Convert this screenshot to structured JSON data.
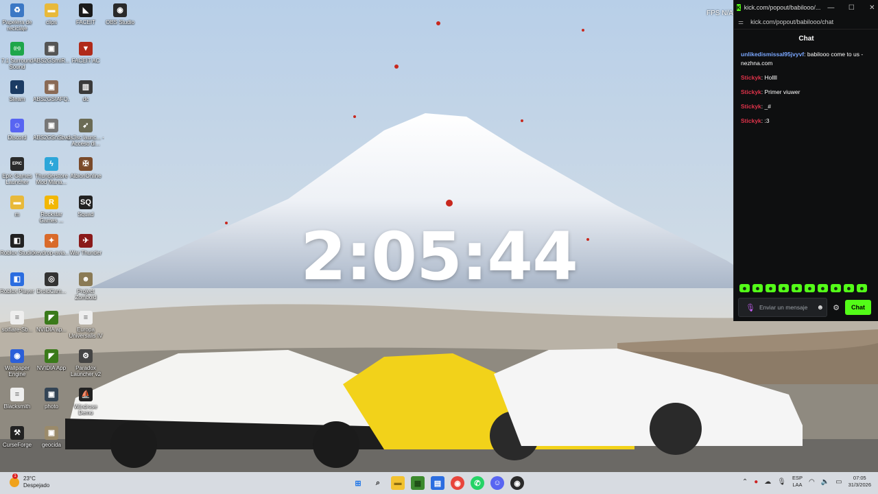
{
  "desktop": {
    "icons": [
      {
        "label": "Papelera de reciclaje",
        "glyph": "♻",
        "color": "#3b78c5",
        "icon": "recycle-bin-icon"
      },
      {
        "label": "clips",
        "glyph": "▬",
        "color": "#e8b93a",
        "icon": "folder-icon"
      },
      {
        "label": "FACEIT",
        "glyph": "◣",
        "color": "#1a1a1a",
        "icon": "faceit-icon"
      },
      {
        "label": "OBS Studio",
        "glyph": "◉",
        "color": "#2a2a2a",
        "icon": "obs-icon"
      },
      {
        "label": "7.1 Surround Sound",
        "glyph": "((•))",
        "color": "#1ea64a",
        "icon": "surround-sound-icon"
      },
      {
        "label": "ABS2GSmIR...",
        "glyph": "▣",
        "color": "#555555",
        "icon": "photo-icon"
      },
      {
        "label": "FACEIT AC",
        "glyph": "▼",
        "color": "#b02a1a",
        "icon": "faceit-ac-icon"
      },
      {
        "label": "Steam",
        "glyph": "◐",
        "color": "#1b3b63",
        "icon": "steam-icon"
      },
      {
        "label": "ABS2GSIAFQ...",
        "glyph": "▣",
        "color": "#8a6a55",
        "icon": "photo-icon"
      },
      {
        "label": "dc",
        "glyph": "▥",
        "color": "#3a3a3a",
        "icon": "shortcut-icon"
      },
      {
        "label": "Discord",
        "glyph": "☺",
        "color": "#5865f2",
        "icon": "discord-icon"
      },
      {
        "label": "ABS2GSnSbw...",
        "glyph": "▣",
        "color": "#777777",
        "icon": "photo-icon"
      },
      {
        "label": "ds3sc launc... - Acceso di...",
        "glyph": "➹",
        "color": "#6b6b55",
        "icon": "launcher-icon"
      },
      {
        "label": "Epic Games Launcher",
        "glyph": "EPIC",
        "color": "#2b2b2b",
        "icon": "epic-games-icon"
      },
      {
        "label": "Thunderstore Mod Mana...",
        "glyph": "ϟ",
        "color": "#2da6d9",
        "icon": "thunderstore-icon"
      },
      {
        "label": "AlbionOnline",
        "glyph": "✠",
        "color": "#7a4a2a",
        "icon": "albion-icon"
      },
      {
        "label": "m",
        "glyph": "▬",
        "color": "#e8b93a",
        "icon": "folder-icon"
      },
      {
        "label": "Rockstar Games ...",
        "glyph": "R",
        "color": "#f2b705",
        "icon": "rockstar-icon"
      },
      {
        "label": "Squad",
        "glyph": "SQ",
        "color": "#222222",
        "icon": "squad-icon"
      },
      {
        "label": "Roblox Studio",
        "glyph": "◧",
        "color": "#222222",
        "icon": "roblox-studio-icon"
      },
      {
        "label": "keydrop-avia...",
        "glyph": "✦",
        "color": "#d96a2a",
        "icon": "keydrop-icon"
      },
      {
        "label": "War Thunder",
        "glyph": "✈",
        "color": "#8a1a1a",
        "icon": "war-thunder-icon"
      },
      {
        "label": "Roblox Player",
        "glyph": "◧",
        "color": "#2b6de0",
        "icon": "roblox-player-icon"
      },
      {
        "label": "DroidCam...",
        "glyph": "◎",
        "color": "#333333",
        "icon": "droidcam-icon"
      },
      {
        "label": "Project Zomboid",
        "glyph": "☻",
        "color": "#8a7a55",
        "icon": "project-zomboid-icon"
      },
      {
        "label": "solfiare-Sb...",
        "glyph": "≡",
        "color": "#eeeeee",
        "icon": "document-icon"
      },
      {
        "label": "NVIDIA ap...",
        "glyph": "◤",
        "color": "#3a7a1a",
        "icon": "nvidia-icon"
      },
      {
        "label": "Europa Universalis IV",
        "glyph": "≡",
        "color": "#eeeeee",
        "icon": "document-icon"
      },
      {
        "label": "Wallpaper Engine",
        "glyph": "◉",
        "color": "#2b5fd9",
        "icon": "wallpaper-engine-icon"
      },
      {
        "label": "NVIDIA App",
        "glyph": "◤",
        "color": "#3a7a1a",
        "icon": "nvidia-icon"
      },
      {
        "label": "Paradox Launcher v2",
        "glyph": "⚙",
        "color": "#444444",
        "icon": "paradox-icon"
      },
      {
        "label": "Blacksmith",
        "glyph": "≡",
        "color": "#eeeeee",
        "icon": "document-icon"
      },
      {
        "label": "photo",
        "glyph": "▣",
        "color": "#334455",
        "icon": "photo-icon"
      },
      {
        "label": "Windrose Demo",
        "glyph": "⛵",
        "color": "#222222",
        "icon": "windrose-icon"
      },
      {
        "label": "CurseForge",
        "glyph": "⚒",
        "color": "#222222",
        "icon": "curseforge-icon"
      },
      {
        "label": "geocida",
        "glyph": "▣",
        "color": "#9a8a6a",
        "icon": "photo-icon"
      }
    ]
  },
  "overlay": {
    "clock": "2:05:44",
    "fps": "FPS  N/A"
  },
  "chat_window": {
    "url_title": "kick.com/popout/babilooo/...",
    "url": "kick.com/popout/babilooo/chat",
    "heading": "Chat",
    "messages": [
      {
        "user": "unlikedismissal95jvyvf",
        "user_color": "#7aa7ff",
        "text": " babilooo come to us - nezhna.com"
      },
      {
        "user": "Stickyk",
        "user_color": "#e0334a",
        "text": " Hollll"
      },
      {
        "user": "Stickyk",
        "user_color": "#e0334a",
        "text": " Primer viuwer"
      },
      {
        "user": "Stickyk",
        "user_color": "#e0334a",
        "text": " _#"
      },
      {
        "user": "Stickyk",
        "user_color": "#e0334a",
        "text": " :3"
      }
    ],
    "input_placeholder": "Enviar un mensaje",
    "send_label": "Chat",
    "accent": "#53fc18"
  },
  "taskbar": {
    "weather_temp": "23°C",
    "weather_desc": "Despejado",
    "lang_top": "ESP",
    "lang_bottom": "LAA",
    "time": "07:05",
    "date": "31/3/2026"
  }
}
